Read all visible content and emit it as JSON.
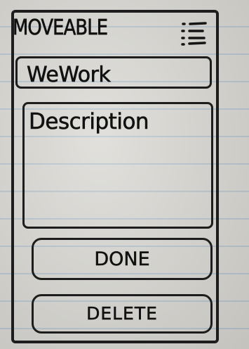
{
  "app": {
    "title": "MOVEABLE",
    "menu_icon": "list-menu-icon"
  },
  "form": {
    "name_value": "WeWork",
    "description_placeholder": "Description"
  },
  "actions": {
    "done_label": "DONE",
    "delete_label": "DELETE"
  }
}
